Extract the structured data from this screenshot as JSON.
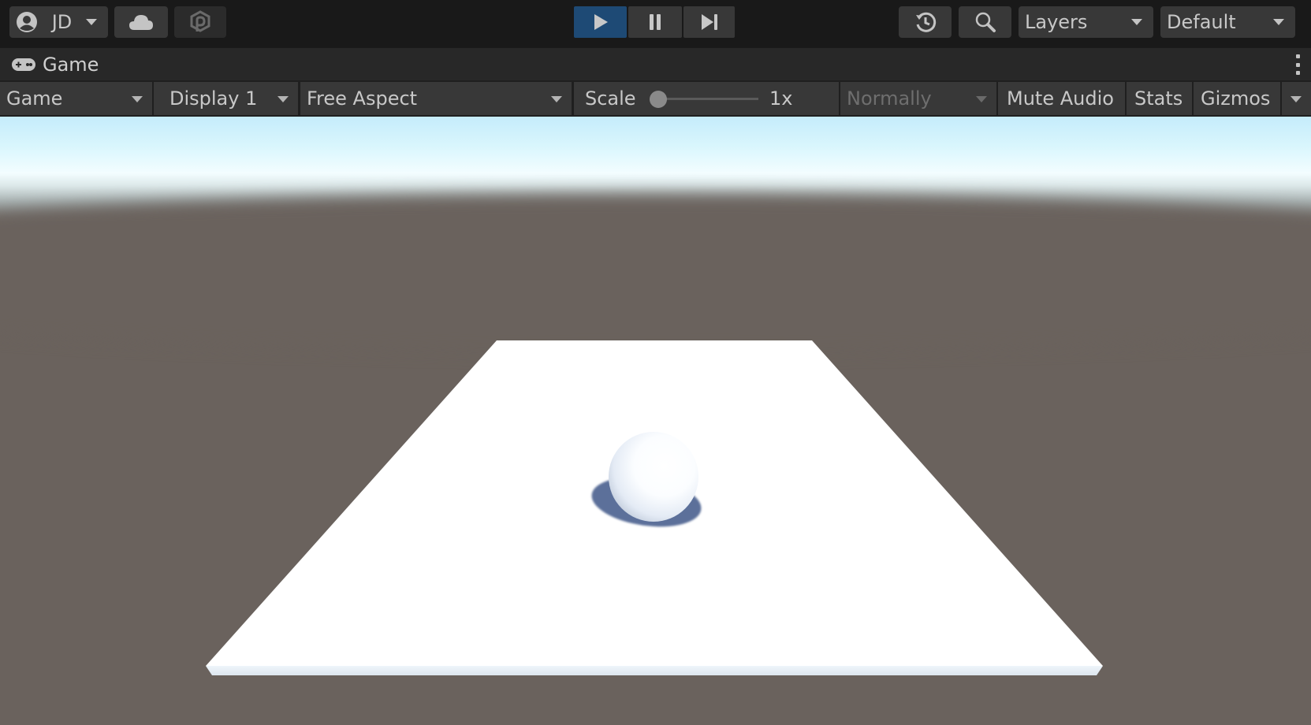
{
  "topbar": {
    "account": {
      "label": "JD",
      "icon": "account-circle-icon"
    },
    "cloud": {
      "icon": "cloud-icon"
    },
    "collab": {
      "icon": "plastic-scm-icon"
    },
    "playmode": {
      "play": {
        "icon": "play-icon",
        "active": true,
        "accent": "#1e4a75"
      },
      "pause": {
        "icon": "pause-icon"
      },
      "step": {
        "icon": "step-icon"
      }
    },
    "history": {
      "icon": "history-icon"
    },
    "search": {
      "icon": "search-icon"
    },
    "layers": {
      "label": "Layers"
    },
    "layout": {
      "label": "Default"
    }
  },
  "tab": {
    "icon": "gamepad-icon",
    "label": "Game",
    "menu_icon": "kebab-menu-icon"
  },
  "game_toolbar": {
    "view_select": "Game",
    "display_select": "Display 1",
    "aspect_select": "Free Aspect",
    "scale_label": "Scale",
    "scale_value": "1x",
    "scale_fraction": 0,
    "play_focus_select": "Normally",
    "mute_audio": "Mute Audio",
    "stats": "Stats",
    "gizmos": "Gizmos"
  },
  "scene": {
    "sky_color": "#d9f6fd",
    "ground_color": "#6a625d",
    "plane_color": "#ffffff",
    "sphere_color": "#ffffff",
    "shadow_color": "#5b6f9a"
  }
}
